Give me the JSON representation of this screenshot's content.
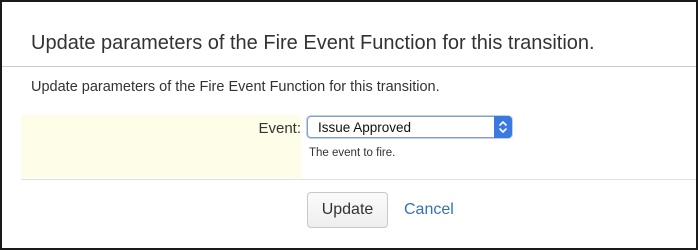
{
  "dialog": {
    "title": "Update parameters of the Fire Event Function for this transition.",
    "description": "Update parameters of the Fire Event Function for this transition."
  },
  "form": {
    "event_field": {
      "label": "Event:",
      "selected_value": "Issue Approved",
      "help_text": "The event to fire.",
      "arrow_icon": "chevron-up-down-icon"
    }
  },
  "actions": {
    "update_label": "Update",
    "cancel_label": "Cancel"
  },
  "colors": {
    "link": "#3572b0",
    "label_cell_background": "#fefde8",
    "select_arrow_background": "#3a7ae0"
  }
}
